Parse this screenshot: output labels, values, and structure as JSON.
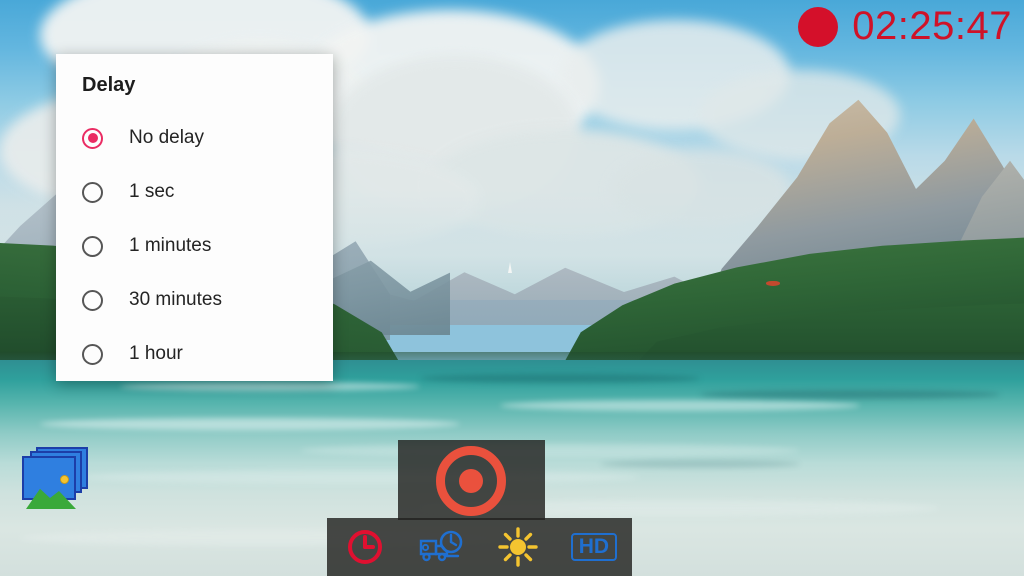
{
  "app": {
    "name": "screen-recorder",
    "scene_description": "mountain lake landscape video preview"
  },
  "recording": {
    "indicator_icon": "record-dot-icon",
    "elapsed_time": "02:25:47",
    "color": "#cf1228"
  },
  "dialog": {
    "title": "Delay",
    "selected_value": "No delay",
    "accent_color": "#ea2c63",
    "options": [
      {
        "label": "No delay",
        "selected": true
      },
      {
        "label": "1 sec",
        "selected": false
      },
      {
        "label": "1 minutes",
        "selected": false
      },
      {
        "label": "30 minutes",
        "selected": false
      },
      {
        "label": "1 hour",
        "selected": false
      }
    ]
  },
  "controls": {
    "record_button": {
      "icon": "record-circle-icon",
      "color": "#ea513d"
    },
    "tools": [
      {
        "icon": "clock-icon",
        "name": "delay-timer",
        "color": "#e01030",
        "label": ""
      },
      {
        "icon": "truck-clock-icon",
        "name": "schedule-recording",
        "color": "#1f6fd0",
        "label": ""
      },
      {
        "icon": "sun-icon",
        "name": "brightness",
        "color": "#f4c430",
        "label": ""
      },
      {
        "icon": "hd-badge-icon",
        "name": "video-quality",
        "color": "#1f6fd0",
        "label": "HD"
      }
    ]
  },
  "gallery": {
    "icon": "gallery-stack-icon",
    "label": ""
  }
}
